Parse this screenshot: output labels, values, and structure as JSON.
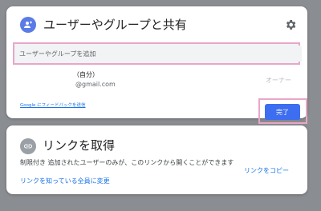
{
  "share_dialog": {
    "title": "ユーザーやグループと共有",
    "input_placeholder": "ユーザーやグループを追加",
    "owner": {
      "name_self": "（自分）",
      "email": "@gmail.com",
      "role": "オーナー"
    },
    "feedback_link": "Google にフィードバックを送信",
    "done_label": "完了"
  },
  "link_dialog": {
    "title": "リンクを取得",
    "description": "制限付き 追加されたユーザーのみが、このリンクから開くことができます",
    "change_label": "リンクを知っている全員に変更",
    "copy_label": "リンクをコピー"
  },
  "colors": {
    "accent": "#3d6df0",
    "link": "#1a73e8",
    "highlight": "#e9a6c8",
    "backdrop": "#8a8d91"
  },
  "icons": {
    "add_person": "add-person-icon",
    "settings": "gear-icon",
    "link": "link-icon"
  }
}
